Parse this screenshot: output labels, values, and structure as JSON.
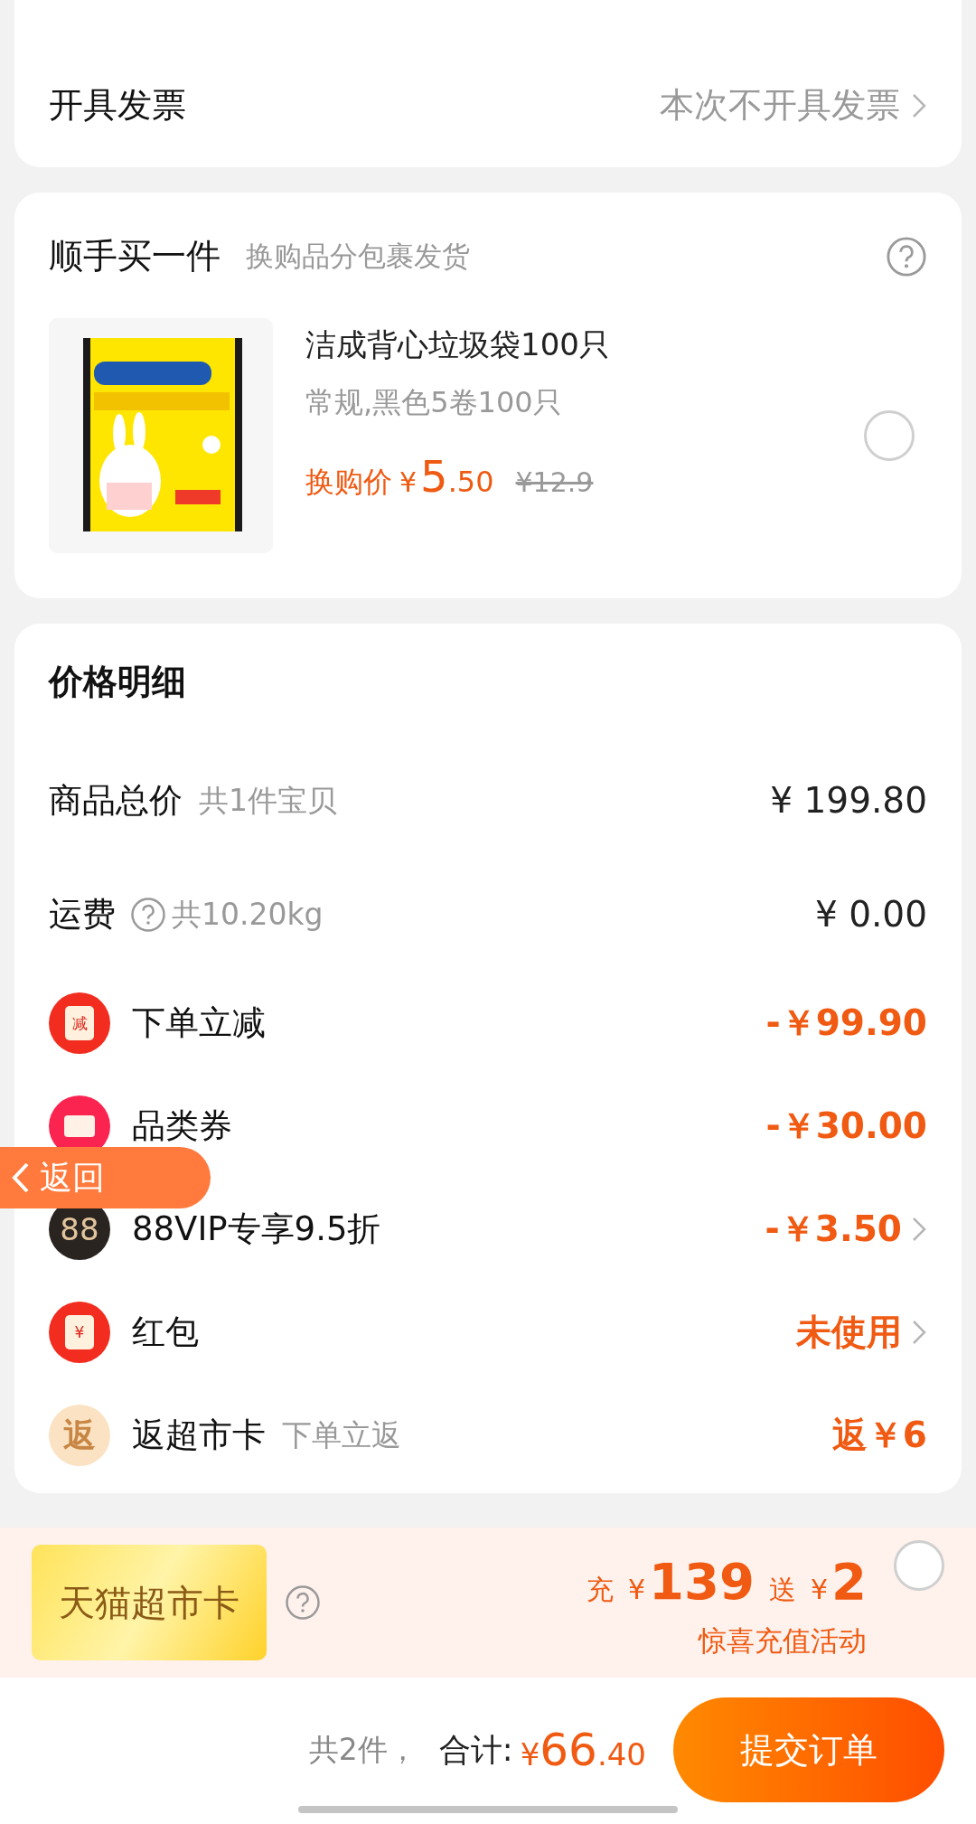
{
  "invoice": {
    "label": "开具发票",
    "value": "本次不开具发票"
  },
  "add_on": {
    "title": "顺手买一件",
    "subtitle": "换购品分包裹发货",
    "product": {
      "name": "洁成背心垃圾袋100只",
      "spec": "常规,黑色5卷100只",
      "price_label": "换购价",
      "currency": "¥",
      "price_int": "5",
      "price_dec": ".50",
      "original_price": "¥12.9",
      "selected": false
    }
  },
  "price_detail": {
    "title": "价格明细",
    "rows": [
      {
        "kind": "subtotal",
        "label": "商品总价",
        "note": "共1件宝贝",
        "value": "¥ 199.80"
      },
      {
        "kind": "shipping",
        "label": "运费",
        "note": "共10.20kg",
        "value": "¥ 0.00"
      },
      {
        "kind": "instant",
        "icon_text": "减",
        "label": "下单立减",
        "value": "-￥99.90"
      },
      {
        "kind": "coupon",
        "label": "品类券",
        "value": "-￥30.00"
      },
      {
        "kind": "vip",
        "icon_text": "88",
        "label": "88VIP专享9.5折",
        "value": "-￥3.50"
      },
      {
        "kind": "redpacket",
        "icon_text": "¥",
        "label": "红包",
        "value": "未使用"
      },
      {
        "kind": "rebate",
        "icon_text": "返",
        "label": "返超市卡",
        "note": "下单立返",
        "value": "返￥6"
      }
    ]
  },
  "back_button": "返回",
  "supermarket_card": {
    "card_label": "天猫超市卡",
    "recharge_label": "充",
    "recharge_currency": "¥",
    "recharge_amount": "139",
    "bonus_label": "送",
    "bonus_currency": "¥",
    "bonus_amount": "2",
    "caption": "惊喜充值活动",
    "selected": false
  },
  "bottom_bar": {
    "count": "共2件，",
    "total_label": "合计:",
    "currency": "¥",
    "total_int": "66",
    "total_dec": ".40",
    "submit": "提交订单"
  }
}
